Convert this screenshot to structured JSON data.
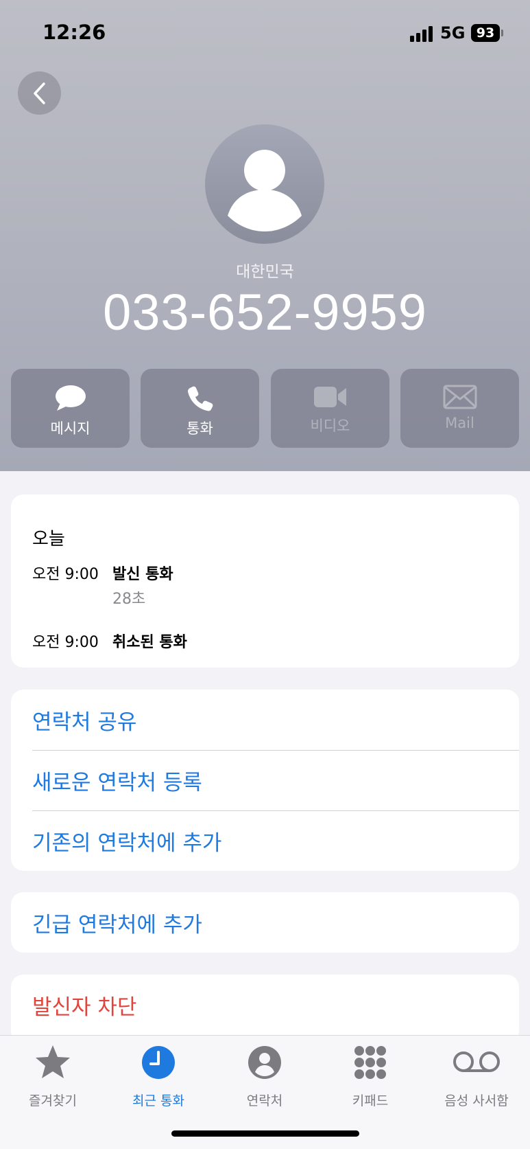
{
  "status": {
    "time": "12:26",
    "network": "5G",
    "battery": "93"
  },
  "contact": {
    "country": "대한민국",
    "number": "033-652-9959"
  },
  "actions": [
    {
      "label": "메시지",
      "icon": "message-icon",
      "enabled": true
    },
    {
      "label": "통화",
      "icon": "phone-icon",
      "enabled": true
    },
    {
      "label": "비디오",
      "icon": "video-icon",
      "enabled": false
    },
    {
      "label": "Mail",
      "icon": "mail-icon",
      "enabled": false
    }
  ],
  "calls": {
    "date": "오늘",
    "entries": [
      {
        "time": "오전 9:00",
        "type": "발신 통화",
        "duration": "28초"
      },
      {
        "time": "오전 9:00",
        "type": "취소된 통화",
        "duration": ""
      }
    ]
  },
  "options": [
    "연락처 공유",
    "새로운 연락처 등록",
    "기존의 연락처에 추가"
  ],
  "emergency": "긴급 연락처에 추가",
  "block": "발신자 차단",
  "tabs": [
    {
      "label": "즐겨찾기",
      "icon": "star-icon",
      "active": false
    },
    {
      "label": "최근 통화",
      "icon": "clock-icon",
      "active": true
    },
    {
      "label": "연락처",
      "icon": "person-circle-icon",
      "active": false
    },
    {
      "label": "키패드",
      "icon": "keypad-icon",
      "active": false
    },
    {
      "label": "음성 사서함",
      "icon": "voicemail-icon",
      "active": false
    }
  ],
  "colors": {
    "accent": "#1f7ae0",
    "destructive": "#e0443c",
    "header_top": "#bdbec6",
    "header_bottom": "#a5a8b6"
  }
}
